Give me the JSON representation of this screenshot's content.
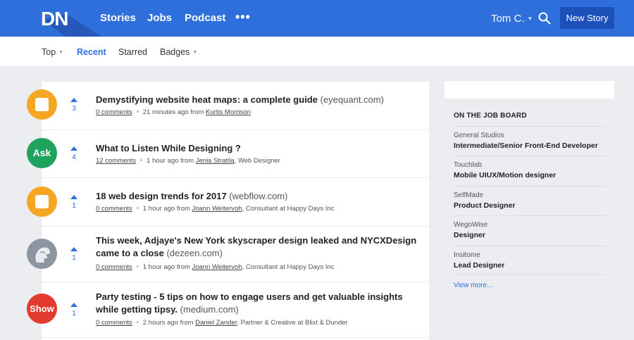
{
  "header": {
    "logo": "DN",
    "nav": [
      "Stories",
      "Jobs",
      "Podcast"
    ],
    "more": "•••",
    "user": "Tom C.",
    "new_story": "New Story",
    "color": "#2f6fdc"
  },
  "subnav": {
    "items": [
      "Top",
      "Recent",
      "Starred",
      "Badges"
    ],
    "active": "Recent"
  },
  "stories": [
    {
      "avatar": "yellow-square-icon",
      "votes": "3",
      "title": "Demystifying website heat maps: a complete guide",
      "domain": "(eyequant.com)",
      "comments": "0 comments",
      "time": "21 minutes ago",
      "from": "from",
      "author": "Kurtis Morrison",
      "role": ""
    },
    {
      "avatar": "Ask",
      "votes": "4",
      "title": "What to Listen While Designing ?",
      "domain": "",
      "comments": "12 comments",
      "time": "1 hour ago",
      "from": "from",
      "author": "Jenia Stratila",
      "role": ", Web Designer"
    },
    {
      "avatar": "yellow-square-icon",
      "votes": "1",
      "title": "18 web design trends for 2017",
      "domain": "(webflow.com)",
      "comments": "0 comments",
      "time": "1 hour ago",
      "from": "from",
      "author": "Joann Weitervoh",
      "role": ", Consultant at Happy Days Inc"
    },
    {
      "avatar": "user-avatar-icon",
      "votes": "1",
      "title": "This week, Adjaye's New York skyscraper design leaked and NYCXDesign came to a close",
      "domain": "(dezeen.com)",
      "comments": "0 comments",
      "time": "1 hour ago",
      "from": "from",
      "author": "Joann Weitervoh",
      "role": ", Consultant at Happy Days Inc"
    },
    {
      "avatar": "Show",
      "votes": "1",
      "title": "Party testing - 5 tips on how to engage users and get valuable insights while getting tipsy.",
      "domain": "(medium.com)",
      "comments": "0 comments",
      "time": "2 hours ago",
      "from": "from",
      "author": "Daniel Zander",
      "role": ", Partner & Creative at Blixt & Dunder"
    }
  ],
  "sidebar": {
    "heading": "ON THE JOB BOARD",
    "jobs": [
      {
        "company": "General Studios",
        "role": "Intermediate/Senior Front-End Developer"
      },
      {
        "company": "Touchlab",
        "role": "Mobile UIUX/Motion designer"
      },
      {
        "company": "SelfMade",
        "role": "Product Designer"
      },
      {
        "company": "WegoWise",
        "role": "Designer"
      },
      {
        "company": "Insitome",
        "role": "Lead Designer"
      }
    ],
    "view_more": "View more..."
  }
}
